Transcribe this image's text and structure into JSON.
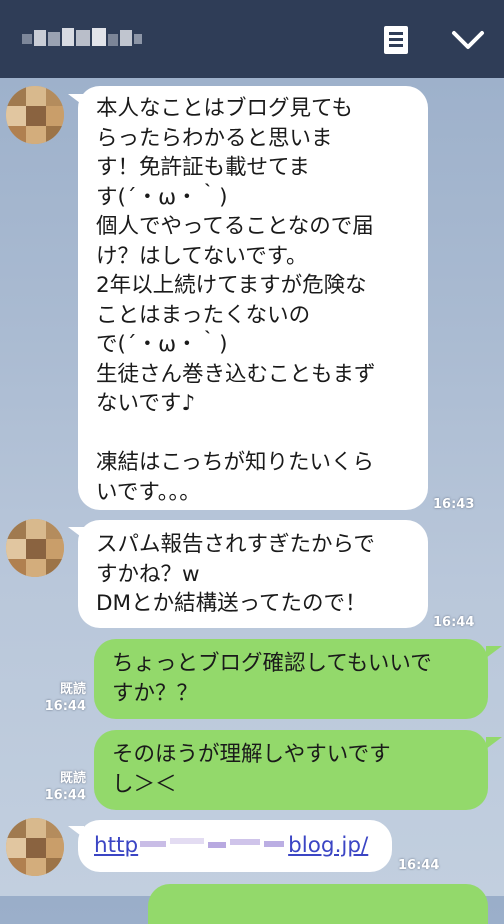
{
  "header": {
    "title": "",
    "note_icon": "note-icon",
    "chevron_icon": "chevron-down-icon",
    "background": "#2f3d57"
  },
  "colors": {
    "incoming_bubble": "#ffffff",
    "outgoing_bubble": "#93d96b",
    "link": "#3b45c4"
  },
  "messages": [
    {
      "direction": "in",
      "lines": [
        "本人なことはブログ見ても",
        "らったらわかると思いま",
        "す！免許証も載せてま",
        "す(´・ω・｀)",
        "個人でやってることなので届",
        "け？はしてないです。",
        "2年以上続けてますが危険な",
        "ことはまったくないの",
        "で(´・ω・｀)",
        "生徒さん巻き込むこともまず",
        "ないです♪",
        "",
        "凍結はこっちが知りたいくら",
        "いです。。。"
      ],
      "time": "16:43"
    },
    {
      "direction": "in",
      "lines": [
        "スパム報告されすぎたからで",
        "すかね？w",
        "DMとか結構送ってたので！"
      ],
      "time": "16:44"
    },
    {
      "direction": "out",
      "lines": [
        "ちょっとブログ確認してもいいで",
        "すか？？"
      ],
      "read": "既読",
      "time": "16:44"
    },
    {
      "direction": "out",
      "lines": [
        "そのほうが理解しやすいです",
        "し＞＜"
      ],
      "read": "既読",
      "time": "16:44"
    },
    {
      "direction": "in",
      "link_prefix": "http",
      "link_suffix": "blog.jp/",
      "time": "16:44"
    }
  ]
}
